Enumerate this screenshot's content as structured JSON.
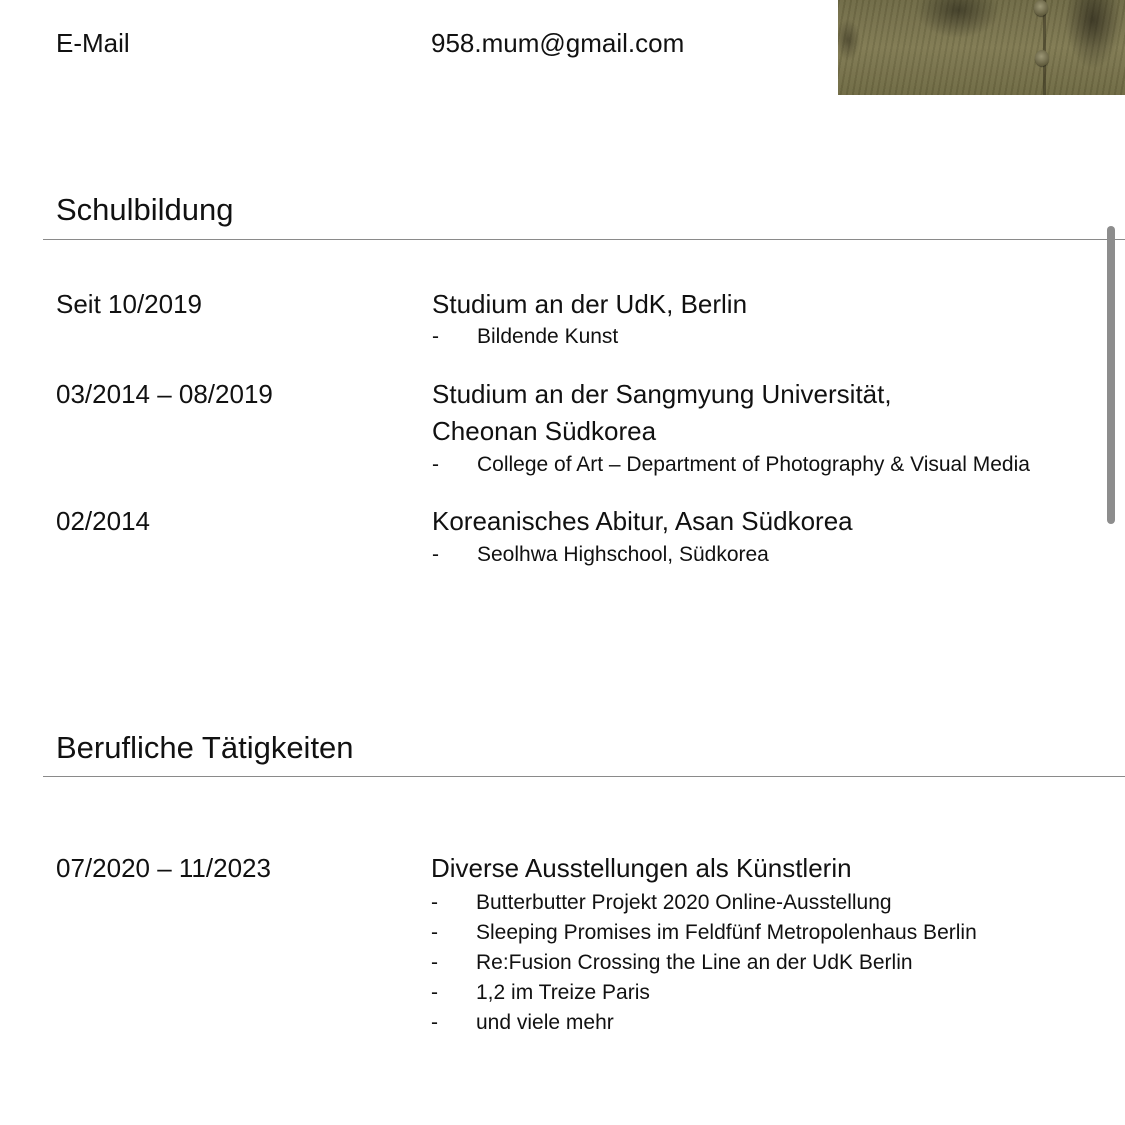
{
  "contact": {
    "email_label": "E-Mail",
    "email_value": "958.mum@gmail.com"
  },
  "education": {
    "heading": "Schulbildung",
    "entries": [
      {
        "date": "Seit 10/2019",
        "title_line1": "Studium an der UdK, Berlin",
        "bullets": [
          "Bildende Kunst"
        ]
      },
      {
        "date": "03/2014 – 08/2019",
        "title_line1": "Studium an der Sangmyung Universität,",
        "title_line2": "Cheonan Südkorea",
        "bullets": [
          "College of Art – Department of Photography & Visual Media"
        ]
      },
      {
        "date": "02/2014",
        "title_line1": "Koreanisches Abitur, Asan Südkorea",
        "bullets": [
          "Seolhwa Highschool, Südkorea"
        ]
      }
    ]
  },
  "work": {
    "heading": "Berufliche Tätigkeiten",
    "entries": [
      {
        "date": "07/2020 – 11/2023",
        "title_line1": "Diverse Ausstellungen als Künstlerin",
        "bullets": [
          "Butterbutter Projekt 2020  Online-Ausstellung",
          "Sleeping Promises im Feldfünf Metropolenhaus Berlin",
          "Re:Fusion Crossing the Line an der UdK Berlin",
          "1,2 im Treize Paris",
          "und viele mehr"
        ]
      }
    ]
  },
  "bullet_marker": "-"
}
